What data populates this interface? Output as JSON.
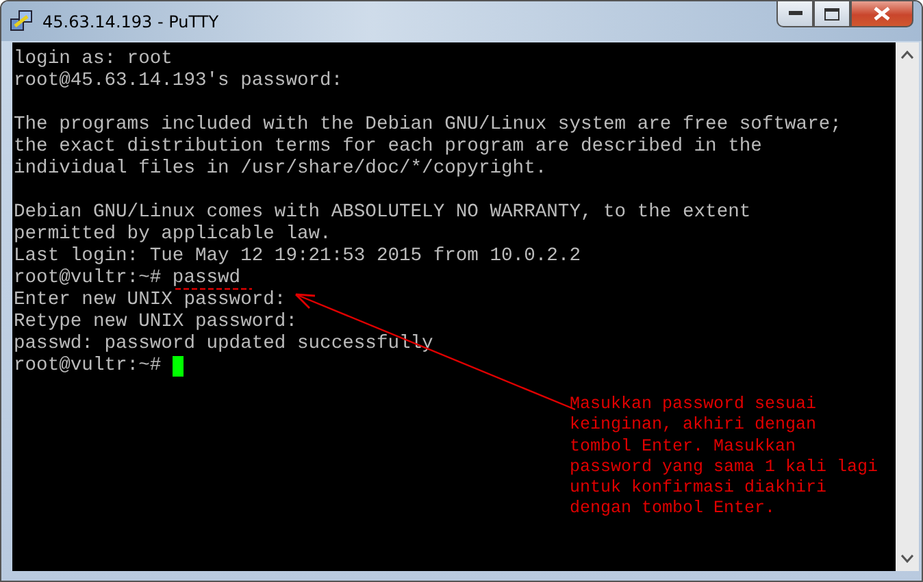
{
  "window": {
    "title": "45.63.14.193 - PuTTY"
  },
  "terminal": {
    "blocks": [
      [
        "login as: root",
        "root@45.63.14.193's password:"
      ],
      [
        "The programs included with the Debian GNU/Linux system are free software;",
        "the exact distribution terms for each program are described in the",
        "individual files in /usr/share/doc/*/copyright."
      ],
      [
        "Debian GNU/Linux comes with ABSOLUTELY NO WARRANTY, to the extent",
        "permitted by applicable law.",
        "Last login: Tue May 12 19:21:53 2015 from 10.0.2.2",
        "root@vultr:~# passwd",
        "Enter new UNIX password:",
        "Retype new UNIX password:",
        "passwd: password updated successfully",
        "root@vultr:~# "
      ]
    ],
    "cursor_visible": true
  },
  "annotation": {
    "lines": [
      "Masukkan password sesuai",
      "keinginan, akhiri dengan",
      "tombol Enter. Masukkan",
      "password yang sama 1 kali lagi",
      "untuk konfirmasi diakhiri",
      "dengan tombol Enter."
    ]
  }
}
